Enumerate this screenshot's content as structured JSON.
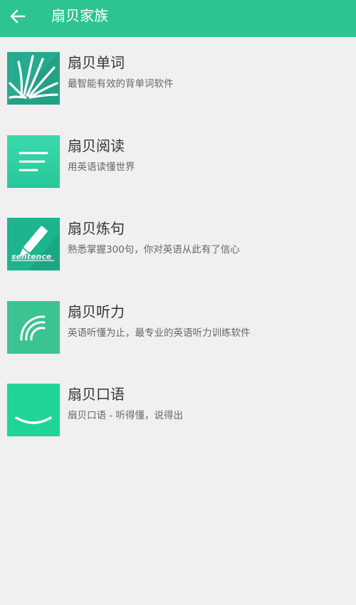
{
  "header": {
    "title": "扇贝家族"
  },
  "apps": [
    {
      "name": "扇贝单词",
      "desc": "最智能有效的背单词软件",
      "icon": "burst-rays-icon",
      "color": "#23a086"
    },
    {
      "name": "扇贝阅读",
      "desc": "用英语读懂世界",
      "icon": "text-lines-icon",
      "color": "#2ed3a3"
    },
    {
      "name": "扇贝炼句",
      "desc": "熟悉掌握300句，你对英语从此有了信心",
      "icon": "pencil-sentence-icon",
      "icon_text": "sentence",
      "color": "#1db48f"
    },
    {
      "name": "扇贝听力",
      "desc": "英语听懂为止，最专业的英语听力训练软件",
      "icon": "sound-waves-icon",
      "color": "#3cc392"
    },
    {
      "name": "扇贝口语",
      "desc": "扇贝口语 - 听得懂，说得出",
      "icon": "smile-icon",
      "color": "#1fd598"
    }
  ]
}
